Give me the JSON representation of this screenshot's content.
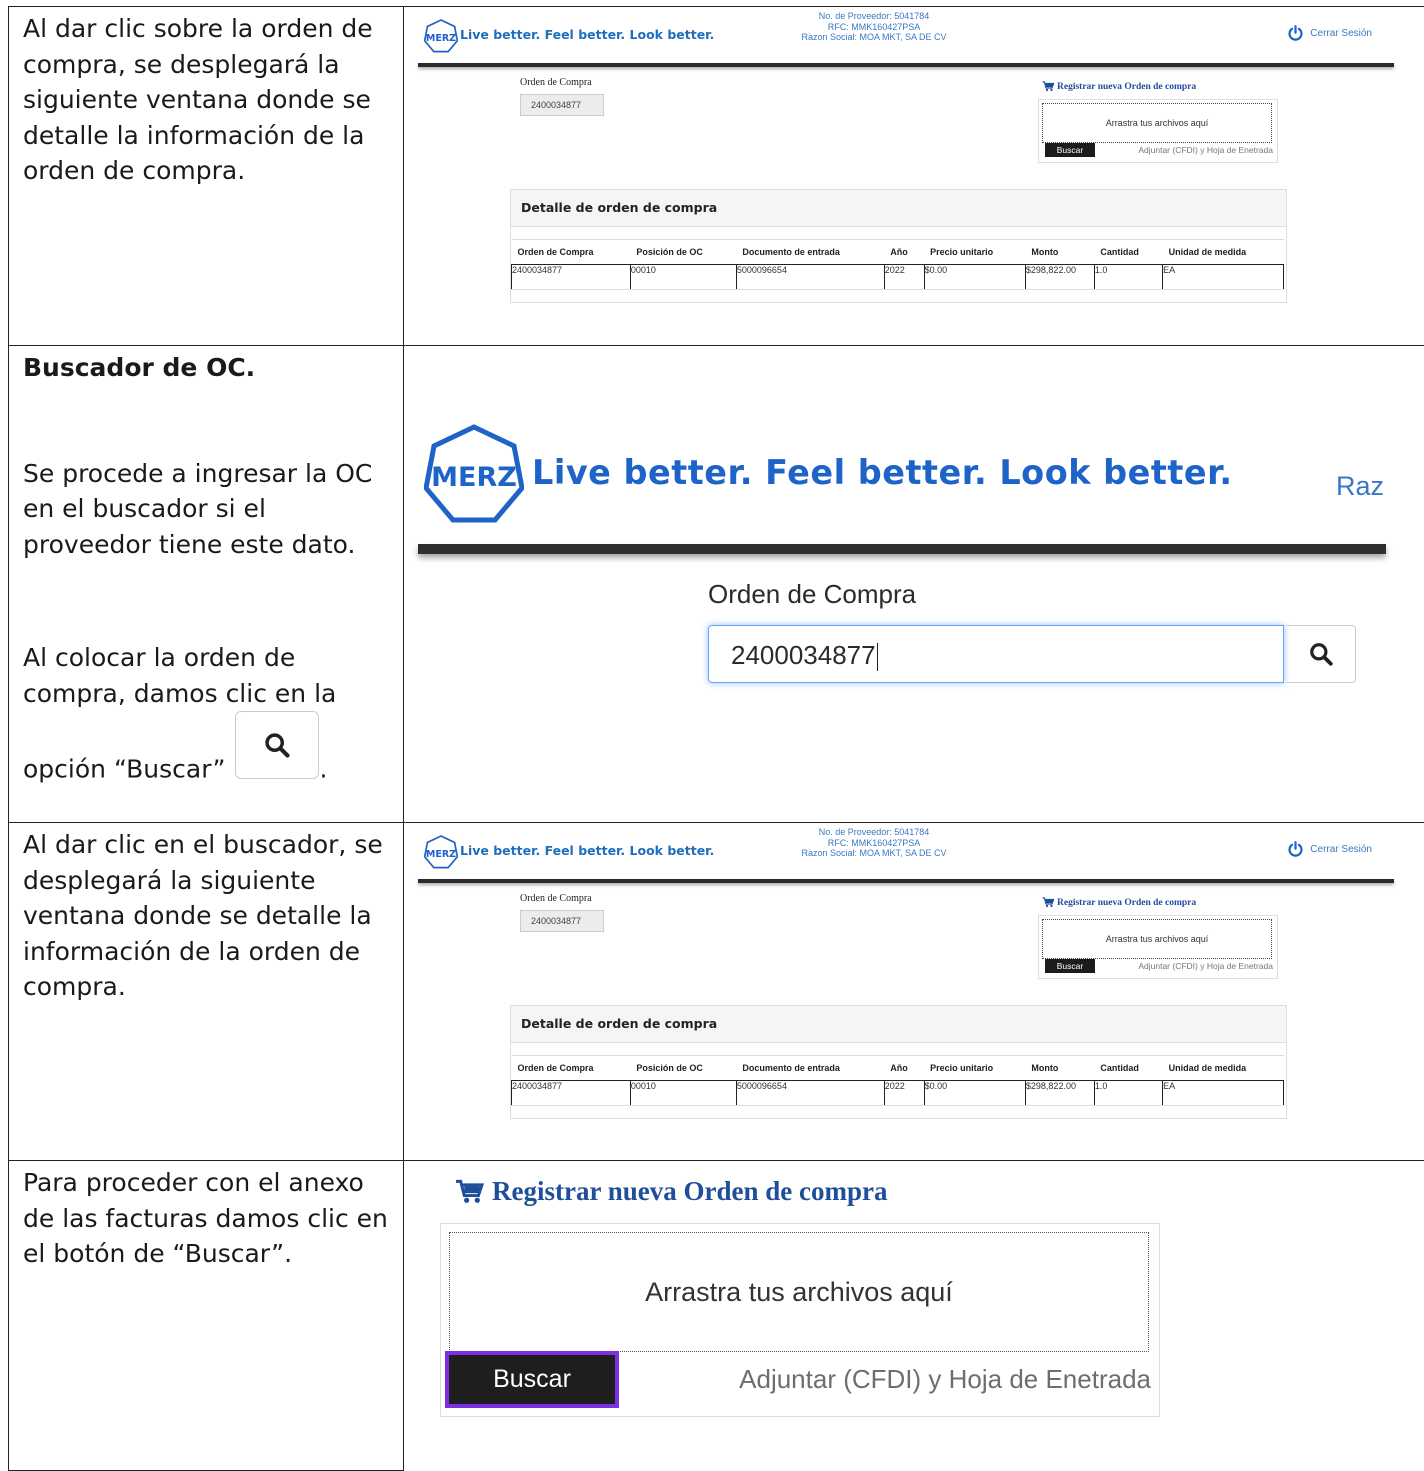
{
  "rows": [
    {
      "text": [
        "Al dar clic sobre la orden de compra, se desplegará la siguiente ventana donde se detalle la información de la orden de compra."
      ]
    },
    {
      "heading": "Buscador de OC.",
      "para1": "Se procede a ingresar la OC en el buscador si el proveedor tiene este dato.",
      "para2a": "Al colocar la orden de compra, damos clic en la",
      "para2b": "opción “Buscar”",
      "para2c": "."
    },
    {
      "text": [
        "Al dar clic en el buscador, se desplegará la siguiente ventana donde se detalle la información de la orden de compra."
      ]
    },
    {
      "text": [
        "Para proceder con el anexo de las facturas damos clic en el botón de “Buscar”."
      ]
    }
  ],
  "portal": {
    "logo_text": "MERZ",
    "tagline": "Live better. Feel better. Look better.",
    "supplier_no": "No. de Proveedor: 5041784",
    "rfc": "RFC: MMK160427PSA",
    "razon": "Razon Social: MOA MKT, SA DE CV",
    "razon_cut": "Raz",
    "logout": "Cerrar Sesión",
    "oc_label": "Orden de Compra",
    "oc_value": "2400034877",
    "register_link": "Registrar nueva Orden de compra",
    "drop_text": "Arrastra tus archivos aquí",
    "search_btn": "Buscar",
    "attach_text": "Adjuntar (CFDI) y Hoja de Enetrada",
    "detail_title": "Detalle de orden de compra",
    "columns": [
      "Orden de Compra",
      "Posición de OC",
      "Documento de entrada",
      "Año",
      "Precio unitario",
      "Monto",
      "Cantidad",
      "Unidad de medida"
    ],
    "row": [
      "2400034877",
      "00010",
      "5000096654",
      "2022",
      "$0.00",
      "$298,822.00",
      "1.0",
      "EA"
    ]
  },
  "colors": {
    "brand_blue": "#1e63c8",
    "link_blue": "#1f4e9a",
    "highlight": "#7b2fe0",
    "dark_bar": "#2b2b2b"
  }
}
